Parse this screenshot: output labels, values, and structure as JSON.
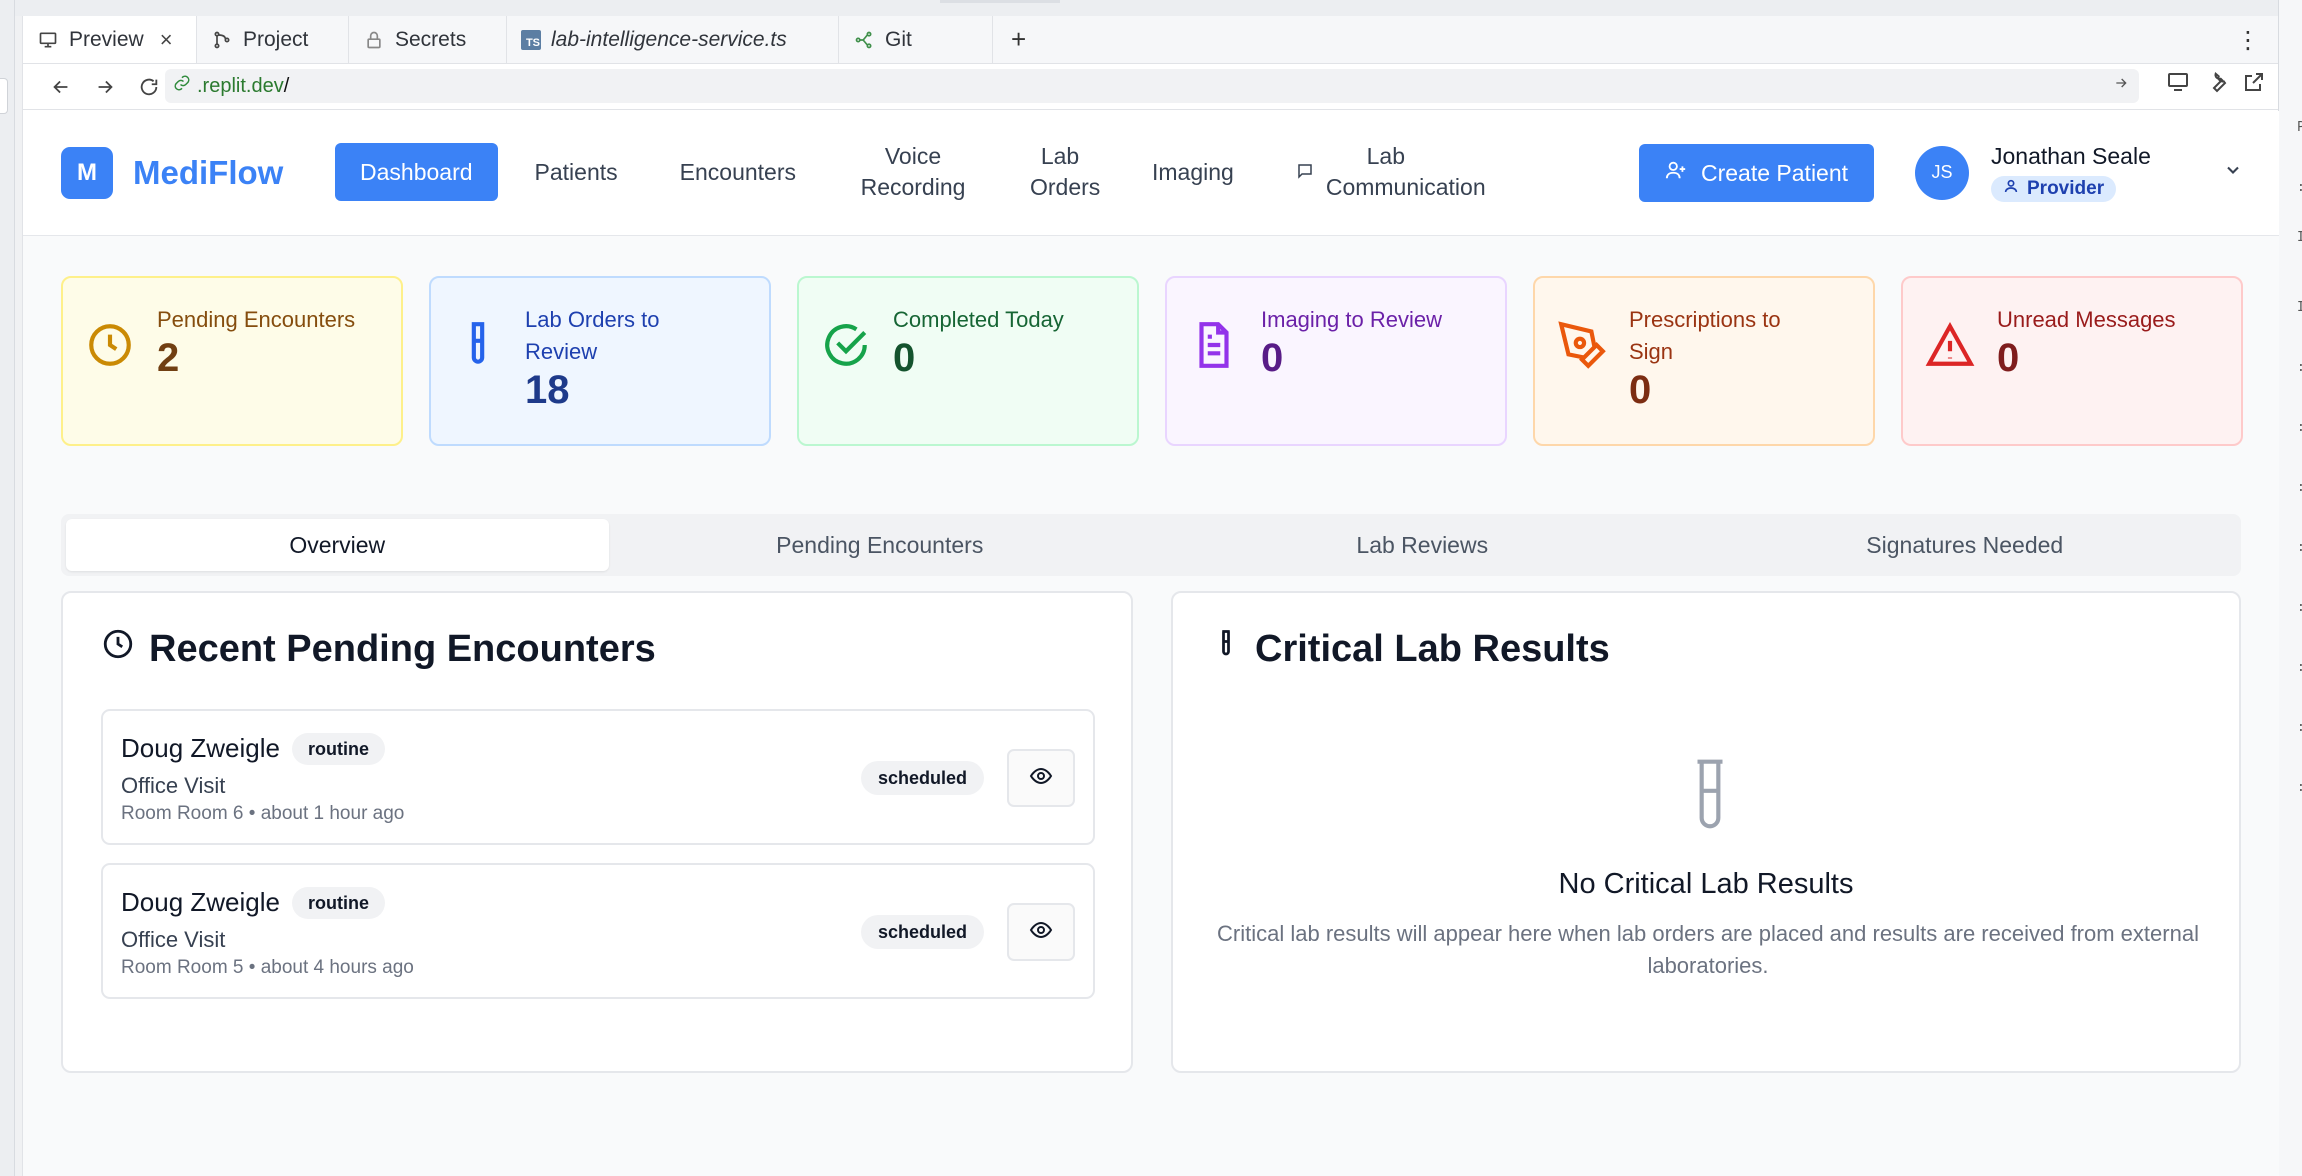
{
  "browser": {
    "tabs": [
      {
        "label": "Preview",
        "icon": "monitor-icon"
      },
      {
        "label": "Project",
        "icon": "branch-icon"
      },
      {
        "label": "Secrets",
        "icon": "lock-icon"
      },
      {
        "label": "lab-intelligence-service.ts",
        "icon": "ts-file-icon",
        "badge": "TS"
      },
      {
        "label": "Git",
        "icon": "git-icon"
      }
    ],
    "url_host": ".replit.dev",
    "url_path": "/"
  },
  "app": {
    "brand_mark": "M",
    "brand_name": "MediFlow",
    "nav": {
      "dashboard": "Dashboard",
      "patients": "Patients",
      "encounters": "Encounters",
      "voice_recording": "Voice Recording",
      "lab_orders": "Lab Orders",
      "imaging": "Imaging",
      "lab_communication": "Lab Communication"
    },
    "create_patient": "Create Patient",
    "user": {
      "initials": "JS",
      "name": "Jonathan Seale",
      "role": "Provider"
    }
  },
  "stats": [
    {
      "label": "Pending Encounters",
      "value": "2",
      "color": "#ca8a04"
    },
    {
      "label": "Lab Orders to Review",
      "value": "18",
      "color": "#2563eb"
    },
    {
      "label": "Completed Today",
      "value": "0",
      "color": "#16a34a"
    },
    {
      "label": "Imaging to Review",
      "value": "0",
      "color": "#9333ea"
    },
    {
      "label": "Prescriptions to Sign",
      "value": "0",
      "color": "#ea580c"
    },
    {
      "label": "Unread Messages",
      "value": "0",
      "color": "#dc2626"
    }
  ],
  "subtabs": [
    "Overview",
    "Pending Encounters",
    "Lab Reviews",
    "Signatures Needed"
  ],
  "recent_pending": {
    "title": "Recent Pending Encounters",
    "items": [
      {
        "name": "Doug Zweigle",
        "priority": "routine",
        "type": "Office Visit",
        "meta": "Room Room 6 • about 1 hour ago",
        "status": "scheduled"
      },
      {
        "name": "Doug Zweigle",
        "priority": "routine",
        "type": "Office Visit",
        "meta": "Room Room 5 • about 4 hours ago",
        "status": "scheduled"
      }
    ]
  },
  "critical_labs": {
    "title": "Critical Lab Results",
    "empty_title": "No Critical Lab Results",
    "empty_desc": "Critical lab results will appear here when lab orders are placed and results are received from external laboratories."
  },
  "colors": {
    "accent": "#3b82f6"
  }
}
